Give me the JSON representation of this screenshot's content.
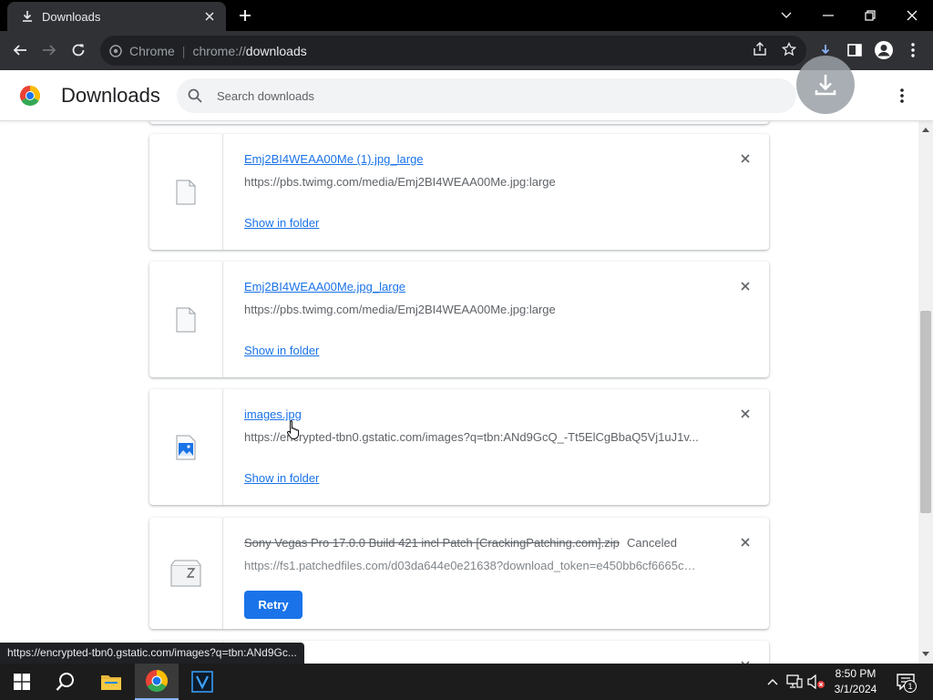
{
  "browser": {
    "tab_title": "Downloads",
    "omnibox_scheme_label": "Chrome",
    "omnibox_prefix": "chrome://",
    "omnibox_host": "downloads"
  },
  "page": {
    "title": "Downloads",
    "search_placeholder": "Search downloads"
  },
  "downloads": [
    {
      "file_name": "Emj2BI4WEAA00Me (1).jpg_large",
      "url": "https://pbs.twimg.com/media/Emj2BI4WEAA00Me.jpg:large",
      "action": "Show in folder",
      "icon": "file-icon"
    },
    {
      "file_name": "Emj2BI4WEAA00Me.jpg_large",
      "url": "https://pbs.twimg.com/media/Emj2BI4WEAA00Me.jpg:large",
      "action": "Show in folder",
      "icon": "file-icon"
    },
    {
      "file_name": "images.jpg",
      "url": "https://encrypted-tbn0.gstatic.com/images?q=tbn:ANd9GcQ_-Tt5ElCgBbaQ5Vj1uJ1v...",
      "action": "Show in folder",
      "icon": "image-file-icon"
    },
    {
      "file_name": "Sony Vegas Pro 17.0.0 Build 421 incl Patch [CrackingPatching.com].zip",
      "status": "Canceled",
      "url": "https://fs1.patchedfiles.com/d03da644e0e21638?download_token=e450bb6cf6665c6...",
      "action": "Retry",
      "icon": "zip-file-icon"
    }
  ],
  "status_bar_url": "https://encrypted-tbn0.gstatic.com/images?q=tbn:ANd9Gc...",
  "taskbar": {
    "time": "8:50 PM",
    "date": "3/1/2024",
    "notification_count": "1"
  },
  "colors": {
    "accent": "#1a73e8",
    "chrome_dark": "#303134",
    "titlebar": "#000000"
  }
}
